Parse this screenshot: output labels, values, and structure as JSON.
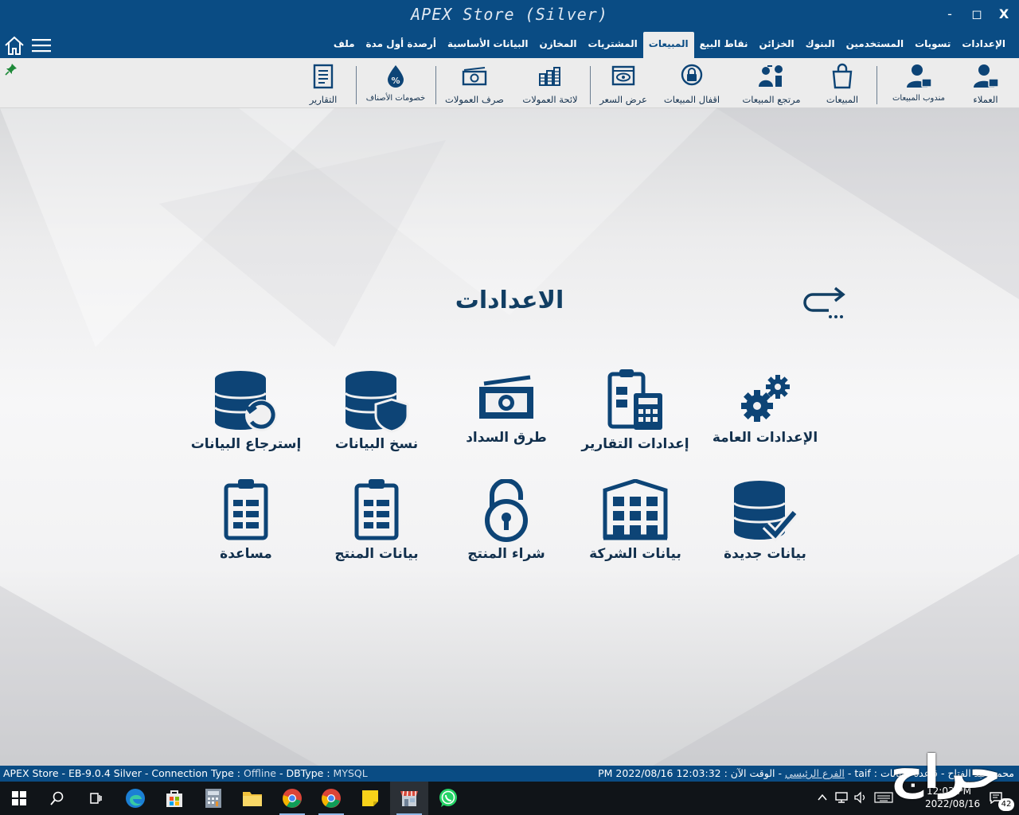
{
  "app": {
    "title": "APEX Store (Silver)",
    "window_controls": {
      "minimize": "-",
      "maximize": "◻",
      "close": "X"
    }
  },
  "menu": {
    "items": [
      {
        "label": "ملف",
        "active": false
      },
      {
        "label": "أرصدة أول مدة",
        "active": false
      },
      {
        "label": "البيانات الأساسية",
        "active": false
      },
      {
        "label": "المخازن",
        "active": false
      },
      {
        "label": "المشتريات",
        "active": false
      },
      {
        "label": "المبيعات",
        "active": true
      },
      {
        "label": "نقاط البيع",
        "active": false
      },
      {
        "label": "الخزائن",
        "active": false
      },
      {
        "label": "البنوك",
        "active": false
      },
      {
        "label": "المستخدمين",
        "active": false
      },
      {
        "label": "تسويات",
        "active": false
      },
      {
        "label": "الإعدادات",
        "active": false
      }
    ]
  },
  "toolbar": {
    "customers": "العملاء",
    "sales_rep": "مندوب المبيعات",
    "sales": "المبيعات",
    "sales_returns": "مرتجع المبيعات",
    "sales_locks": "اقفال المبيعات",
    "price_quote": "عرض السعر",
    "commission_list": "لائحة العمولات",
    "commission_payout": "صرف العمولات",
    "item_discounts": "خصومات الأصناف",
    "reports": "التقارير"
  },
  "main": {
    "title": "الاعدادات",
    "tiles": {
      "general_settings": "الإعدادات العامة",
      "report_settings": "إعدادات التقارير",
      "payment_methods": "طرق السداد",
      "backup_data": "نسخ البيانات",
      "restore_data": "إسترجاع البيانات",
      "new_data": "بيانات جديدة",
      "company_data": "بيانات الشركة",
      "buy_product": "شراء المنتج",
      "product_data": "بيانات المنتج",
      "help": "مساعدة"
    }
  },
  "status": {
    "app_version": "APEX Store - EB-9.0.4 Silver",
    "connection_label": "Connection Type :",
    "connection_value": "Offline",
    "dbtype_label": "DBType :",
    "dbtype_value": "MYSQL",
    "right_text": "محمد عبد الفتاح - قاعدة البيانات : taif - ",
    "branch": "الفرع الرئيسي",
    "time_label": " - الوقت الآن : ",
    "time_value": "12:03:32 2022/08/16 PM"
  },
  "taskbar": {
    "clock_time": "12:03 PM",
    "clock_date": "2022/08/16",
    "notifications": "42",
    "watermark": "حراج"
  },
  "colors": {
    "primary": "#0a4c84",
    "icon": "#0d4476",
    "toolbar_bg": "#ececec"
  }
}
